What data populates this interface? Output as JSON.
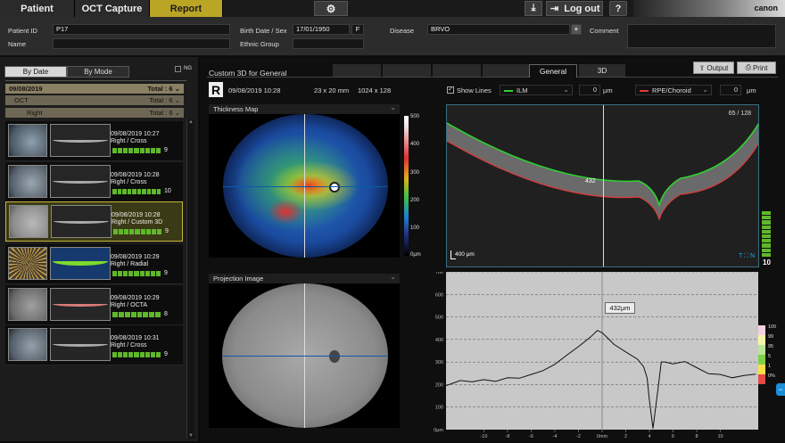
{
  "nav": {
    "tabs": [
      "Patient",
      "OCT Capture",
      "Report"
    ],
    "logout": "Log out",
    "help": "?",
    "brand": "canon"
  },
  "patient": {
    "id_label": "Patient ID",
    "id": "P17",
    "name_label": "Name",
    "name": "",
    "dob_label": "Birth Date / Sex",
    "dob": "17/01/1950",
    "sex": "F",
    "ethnic_label": "Ethnic Group",
    "ethnic": "",
    "disease_label": "Disease",
    "disease": "BRVO",
    "comment_label": "Comment",
    "comment": ""
  },
  "sidebar": {
    "tabs": [
      "By Date",
      "By Mode"
    ],
    "ng": "NG",
    "tree": [
      {
        "label": "09/08/2019",
        "total": "Total : 6"
      },
      {
        "label": "OCT",
        "total": "Total : 6"
      },
      {
        "label": "Right",
        "total": "Total : 6"
      }
    ],
    "scans": [
      {
        "date": "09/08/2019 10:27",
        "type": "Right / Cross",
        "quality": 9
      },
      {
        "date": "09/08/2019 10:28",
        "type": "Right / Cross",
        "quality": 10
      },
      {
        "date": "09/08/2019 10:28",
        "type": "Right / Custom 3D",
        "quality": 9
      },
      {
        "date": "09/08/2019 10:29",
        "type": "Right / Radial",
        "quality": 9
      },
      {
        "date": "09/08/2019 10:29",
        "type": "Right / OCTA",
        "quality": 8
      },
      {
        "date": "09/08/2019 10:31",
        "type": "Right / Cross",
        "quality": 9
      }
    ]
  },
  "report": {
    "title": "Custom 3D for General",
    "tabs": [
      "General",
      "3D"
    ],
    "output": "Output",
    "print": "Print",
    "eye": "R",
    "datetime": "09/08/2019  10:28",
    "size": "23 x 20 mm",
    "resolution": "1024 x 128",
    "show_lines": "Show Lines",
    "ilm": "ILM",
    "ilm_offset": "0",
    "rpe": "RPE/Choroid",
    "rpe_offset": "0",
    "um": "μm",
    "thickness_title": "Thickness Map",
    "projection_title": "Projection Image",
    "scale_labels": [
      "500",
      "400",
      "300",
      "200",
      "100",
      "0μm"
    ],
    "slice": "65 / 128",
    "scalebar": "400 μm",
    "quality_value": "10",
    "tooltip": "432μm",
    "bscan_marker": "432",
    "legend": [
      "100",
      "99",
      "95",
      "5",
      "1",
      "0%"
    ]
  },
  "chart_data": {
    "type": "line",
    "series": [
      {
        "x": [
          -13.2,
          -12,
          -11,
          -10,
          -9,
          -8,
          -7,
          -6,
          -5,
          -4,
          -3,
          -2,
          -1,
          -0.4,
          0,
          0.5,
          1,
          2,
          3,
          3.5,
          3.8,
          4.0,
          4.3,
          4.7,
          5,
          5.3,
          6,
          7,
          8,
          9,
          10,
          11,
          12,
          13
        ],
        "y": [
          195,
          218,
          212,
          222,
          214,
          230,
          228,
          245,
          262,
          290,
          330,
          368,
          410,
          440,
          430,
          405,
          378,
          345,
          312,
          280,
          230,
          130,
          5,
          170,
          300,
          300,
          292,
          302,
          275,
          248,
          245,
          230,
          240,
          246
        ]
      }
    ],
    "xticks": [
      -10,
      -8,
      -6,
      -4,
      -2,
      0,
      2,
      4,
      6,
      8,
      10
    ],
    "xticklabels": [
      "-10",
      "-8",
      "-6",
      "-4",
      "-2",
      "0mm",
      "2",
      "4",
      "6",
      "8",
      "10"
    ],
    "yticks": [
      0,
      100,
      200,
      300,
      400,
      500,
      600,
      700
    ],
    "yticklabels": [
      "0μm",
      "100",
      "200",
      "300",
      "400",
      "500",
      "600",
      "700"
    ],
    "xlim": [
      -13.2,
      13.2
    ],
    "ylim": [
      0,
      700
    ],
    "grid": true,
    "cursor_x": 0
  }
}
